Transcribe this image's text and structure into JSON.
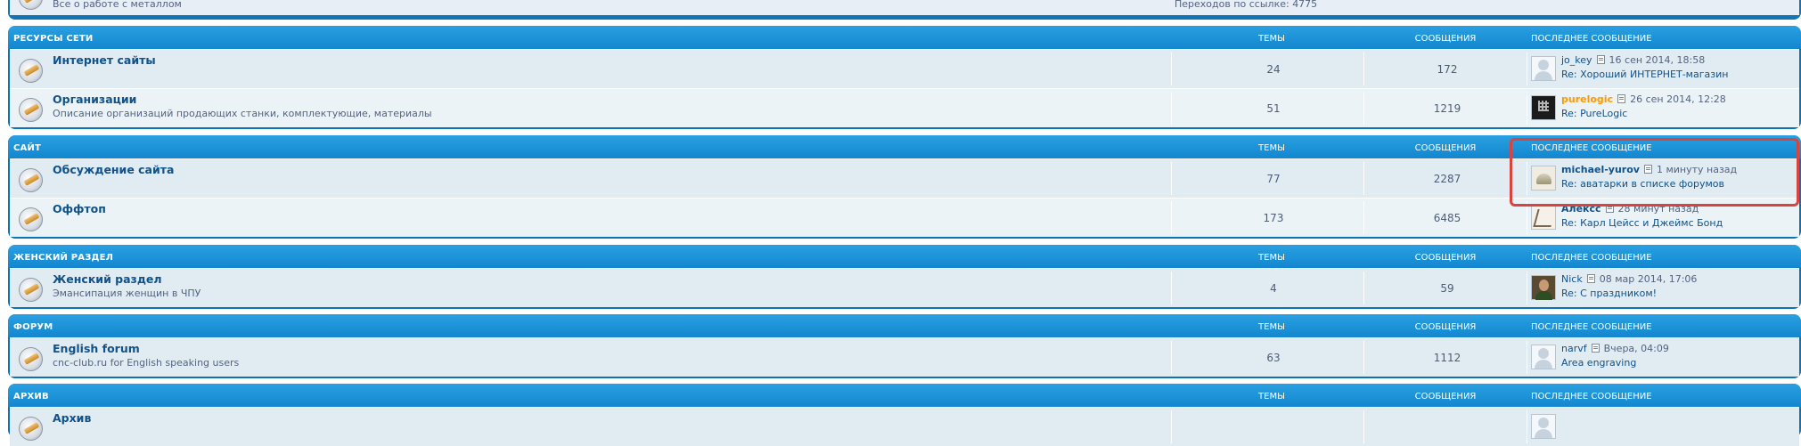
{
  "top_partial": {
    "description": "Все о работе с металлом",
    "redirects": "Переходов по ссылке: 4775"
  },
  "categories": [
    {
      "title": "РЕСУРСЫ СЕТИ",
      "col_topics": "ТЕМЫ",
      "col_posts": "СООБЩЕНИЯ",
      "col_last": "ПОСЛЕДНЕЕ СООБЩЕНИЕ",
      "forums": [
        {
          "title": "Интернет сайты",
          "description": "",
          "topics": "24",
          "posts": "172",
          "last_user": "jo_key",
          "last_time": "16 сен 2014, 18:58",
          "last_subject": "Re: Хороший ИНТЕРНЕТ-магазин",
          "avatar": "default-avatar"
        },
        {
          "title": "Организации",
          "description": "Описание организаций продающих станки, комплектующие, материалы",
          "topics": "51",
          "posts": "1219",
          "last_user": "purelogic",
          "last_time": "26 сен 2014, 12:28",
          "last_subject": "Re: PureLogic",
          "avatar": "purelogic-avatar"
        }
      ]
    },
    {
      "title": "САЙТ",
      "col_topics": "ТЕМЫ",
      "col_posts": "СООБЩЕНИЯ",
      "col_last": "ПОСЛЕДНЕЕ СООБЩЕНИЕ",
      "forums": [
        {
          "title": "Обсуждение сайта",
          "description": "",
          "topics": "77",
          "posts": "2287",
          "last_user": "michael-yurov",
          "last_time": "1 минуту назад",
          "last_subject": "Re: аватарки в списке форумов",
          "avatar": "helmet-avatar"
        },
        {
          "title": "Оффтоп",
          "description": "",
          "topics": "173",
          "posts": "6485",
          "last_user": "Алексс",
          "last_time": "28 минут назад",
          "last_subject": "Re: Карл Цейсс и Джеймс Бонд",
          "avatar": "drawing-avatar"
        }
      ]
    },
    {
      "title": "ЖЕНСКИЙ РАЗДЕЛ",
      "col_topics": "ТЕМЫ",
      "col_posts": "СООБЩЕНИЯ",
      "col_last": "ПОСЛЕДНЕЕ СООБЩЕНИЕ",
      "forums": [
        {
          "title": "Женский раздел",
          "description": "Эмансипация женщин в ЧПУ",
          "topics": "4",
          "posts": "59",
          "last_user": "Nick",
          "last_time": "08 мар 2014, 17:06",
          "last_subject": "Re: С праздником!",
          "avatar": "photo-avatar"
        }
      ]
    },
    {
      "title": "ФОРУМ",
      "col_topics": "ТЕМЫ",
      "col_posts": "СООБЩЕНИЯ",
      "col_last": "ПОСЛЕДНЕЕ СООБЩЕНИЕ",
      "forums": [
        {
          "title": "English forum",
          "description": "cnc-club.ru for English speaking users",
          "topics": "63",
          "posts": "1112",
          "last_user": "narvf",
          "last_time": "Вчера, 04:09",
          "last_subject": "Area engraving",
          "avatar": "default-avatar"
        }
      ]
    },
    {
      "title": "АРХИВ",
      "col_topics": "ТЕМЫ",
      "col_posts": "СООБЩЕНИЯ",
      "col_last": "ПОСЛЕДНЕЕ СООБЩЕНИЕ",
      "forums": [
        {
          "title": "Архив"
        }
      ]
    }
  ],
  "colors": {
    "header": "#1287cf",
    "row": "#e1ebf2",
    "link": "#105289",
    "highlight": "#d9443e",
    "orange_user": "#ff9900"
  }
}
